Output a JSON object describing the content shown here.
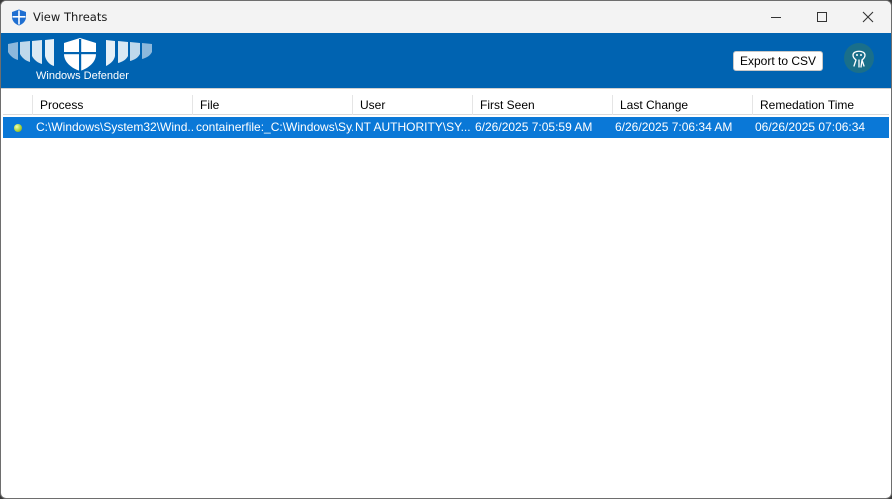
{
  "window": {
    "title": "View Threats",
    "icon": "shield-icon"
  },
  "banner": {
    "brand": "Windows Defender",
    "export_label": "Export to CSV",
    "logo_icon": "windows-defender-shields-logo",
    "right_icon": "octopus-icon",
    "background": "#0063b1"
  },
  "table": {
    "columns": [
      "",
      "Process",
      "File",
      "User",
      "First Seen",
      "Last Change",
      "Remedation Time"
    ],
    "rows": [
      {
        "status": "status-dot-icon",
        "process": "C:\\Windows\\System32\\Wind...",
        "file": "containerfile:_C:\\Windows\\Sy...",
        "user": "NT AUTHORITY\\SY...",
        "first_seen": "6/26/2025 7:05:59 AM",
        "last_change": "6/26/2025 7:06:34 AM",
        "remediation_time": "06/26/2025 07:06:34"
      }
    ],
    "selection_color": "#0a78d7"
  }
}
